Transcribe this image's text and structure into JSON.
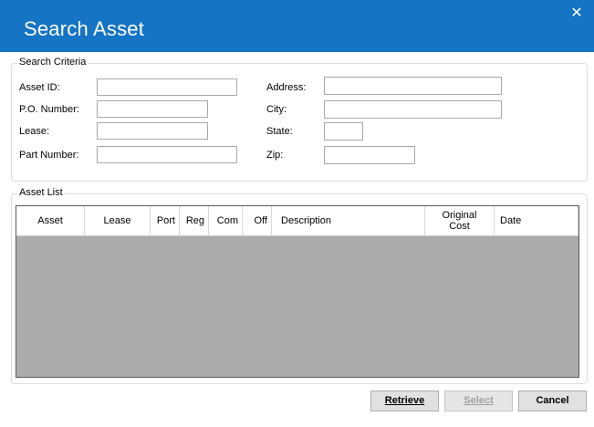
{
  "window": {
    "title": "Search Asset",
    "close_glyph": "✕"
  },
  "search_criteria": {
    "legend": "Search Criteria",
    "fields": {
      "asset_id": {
        "label": "Asset ID:",
        "value": ""
      },
      "po_number": {
        "label": "P.O. Number:",
        "value": ""
      },
      "lease": {
        "label": "Lease:",
        "value": ""
      },
      "part_number": {
        "label": "Part Number:",
        "value": ""
      },
      "address": {
        "label": "Address:",
        "value": ""
      },
      "city": {
        "label": "City:",
        "value": ""
      },
      "state": {
        "label": "State:",
        "value": ""
      },
      "zip": {
        "label": "Zip:",
        "value": ""
      }
    }
  },
  "asset_list": {
    "legend": "Asset List",
    "columns": [
      {
        "label": "Asset"
      },
      {
        "label": "Lease"
      },
      {
        "label": "Port"
      },
      {
        "label": "Reg"
      },
      {
        "label": "Com"
      },
      {
        "label": "Off"
      },
      {
        "label": "Description"
      },
      {
        "label": "Original Cost"
      },
      {
        "label": "Date"
      }
    ],
    "rows": []
  },
  "buttons": {
    "retrieve": {
      "label": "Retrieve",
      "enabled": true
    },
    "select": {
      "label": "Select",
      "enabled": false
    },
    "cancel": {
      "label": "Cancel",
      "enabled": true
    }
  },
  "colors": {
    "titlebar": "#1674c4",
    "grid_background": "#ababab"
  }
}
